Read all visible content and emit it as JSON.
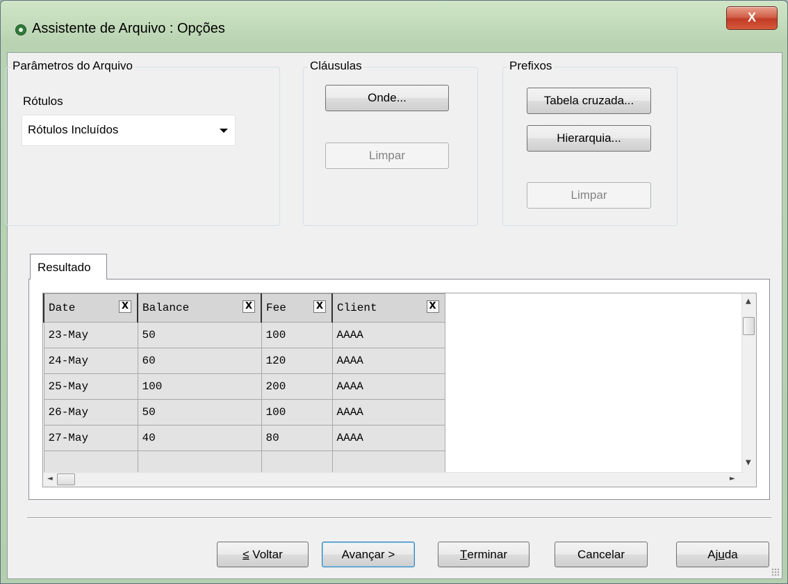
{
  "window": {
    "title": "Assistente de Arquivo : Opções",
    "close_glyph": "X"
  },
  "file_params": {
    "legend": "Parâmetros do Arquivo",
    "labels_caption": "Rótulos",
    "labels_value": "Rótulos Incluídos"
  },
  "clauses": {
    "legend": "Cláusulas",
    "where_label": "Onde...",
    "clear_label": "Limpar"
  },
  "prefixes": {
    "legend": "Prefixos",
    "crosstable_label": "Tabela cruzada...",
    "hierarchy_label": "Hierarquia...",
    "clear_label": "Limpar"
  },
  "result": {
    "tab_label": "Resultado",
    "columns": [
      "Date",
      "Balance",
      "Fee",
      "Client"
    ],
    "column_close_glyph": "X",
    "rows": [
      [
        "23-May",
        "50",
        "100",
        "AAAA"
      ],
      [
        "24-May",
        "60",
        "120",
        "AAAA"
      ],
      [
        "25-May",
        "100",
        "200",
        "AAAA"
      ],
      [
        "26-May",
        "50",
        "100",
        "AAAA"
      ],
      [
        "27-May",
        "40",
        "80",
        "AAAA"
      ]
    ]
  },
  "footer": {
    "back_prefix": "≤",
    "back_label": "Voltar",
    "next_label": "Avançar >",
    "finish_mnemonic": "T",
    "finish_rest": "erminar",
    "cancel_label": "Cancelar",
    "help_start": "Aj",
    "help_mnemonic": "u",
    "help_end": "da"
  }
}
